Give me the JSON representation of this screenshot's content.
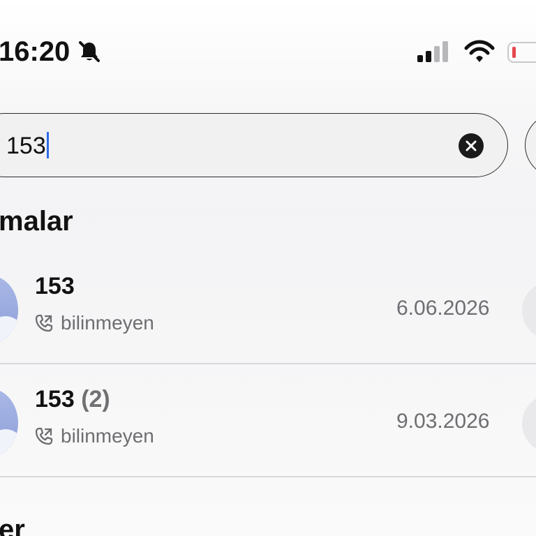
{
  "status_bar": {
    "time": "16:20",
    "icons": {
      "silent": "bell-slash-icon",
      "signal": "cellular-signal-icon",
      "wifi": "wifi-icon",
      "battery": "battery-low-icon"
    },
    "battery_accent": "#e5484d"
  },
  "search": {
    "value": "153",
    "clear_icon": "xmark-circle-icon",
    "caret_color": "#2f6be7"
  },
  "sections": [
    {
      "title": "malar",
      "items": [
        {
          "title": "153",
          "count": "",
          "subtitle": "bilinmeyen",
          "date": "6.06.2026",
          "icon": "outgoing-call-icon"
        },
        {
          "title": "153",
          "count": "(2)",
          "subtitle": "bilinmeyen",
          "date": "9.03.2026",
          "icon": "outgoing-call-icon"
        }
      ]
    },
    {
      "title": "er"
    }
  ]
}
